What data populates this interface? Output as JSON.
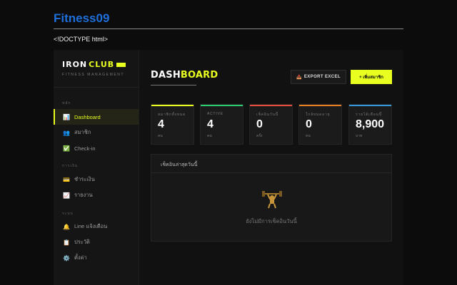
{
  "page": {
    "heading": "Fitness09",
    "doctype_text": "<!DOCTYPE html>"
  },
  "sidebar": {
    "brand": {
      "part1": "IRON",
      "part2": "CLUB",
      "subtitle": "FITNESS MANAGEMENT"
    },
    "sections": [
      {
        "label": "หลัก",
        "items": [
          {
            "label": "Dashboard",
            "icon": "bar-chart-icon",
            "active": true
          },
          {
            "label": "สมาชิก",
            "icon": "users-icon",
            "active": false
          },
          {
            "label": "Check-in",
            "icon": "check-icon",
            "active": false
          }
        ]
      },
      {
        "label": "การเงิน",
        "items": [
          {
            "label": "ชำระเงิน",
            "icon": "credit-card-icon",
            "active": false
          },
          {
            "label": "รายงาน",
            "icon": "trend-chart-icon",
            "active": false
          }
        ]
      },
      {
        "label": "ระบบ",
        "items": [
          {
            "label": "Line แจ้งเตือน",
            "icon": "bell-icon",
            "active": false
          },
          {
            "label": "ประวัติ",
            "icon": "clipboard-icon",
            "active": false
          },
          {
            "label": "ตั้งค่า",
            "icon": "gear-icon",
            "active": false
          }
        ]
      }
    ]
  },
  "header": {
    "title_part1": "DASH",
    "title_part2": "BOARD",
    "export_button": "EXPORT EXCEL",
    "add_button": "+ เพิ่มสมาชิก"
  },
  "stats": [
    {
      "label": "สมาชิกทั้งหมด",
      "value": "4",
      "unit": "คน",
      "color": "#e8ff1f"
    },
    {
      "label": "ACTIVE",
      "value": "4",
      "unit": "คน",
      "color": "#2ecc71"
    },
    {
      "label": "เช็คอินวันนี้",
      "value": "0",
      "unit": "ครั้ง",
      "color": "#e74c3c"
    },
    {
      "label": "ใกล้หมดอายุ",
      "value": "0",
      "unit": "คน",
      "color": "#e67e22"
    },
    {
      "label": "รายได้เดือนนี้",
      "value": "8,900",
      "unit": "บาท",
      "color": "#3498db"
    }
  ],
  "checkin_panel": {
    "title": "เช็คอินล่าสุดวันนี้",
    "empty_text": "ยังไม่มีการเช็คอินวันนี้",
    "empty_icon": "weightlifter-icon"
  },
  "colors": {
    "accent": "#e8ff1f",
    "heading": "#1e6fd9"
  }
}
